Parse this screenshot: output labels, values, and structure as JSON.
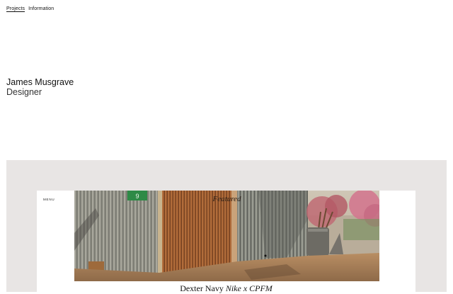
{
  "nav": {
    "items": [
      {
        "label": "Projects",
        "active": true
      },
      {
        "label": "Information",
        "active": false
      }
    ]
  },
  "identity": {
    "name": "James Musgrave",
    "role": "Designer"
  },
  "showcase": {
    "menu_label": "MENU",
    "featured_label": "Featured",
    "project_title_main": "Dexter Navy",
    "project_title_sub": "Nike x CPFM",
    "colors": {
      "background": "#ffffff",
      "showcase_bg": "#e8e5e4",
      "text": "#111111"
    }
  }
}
